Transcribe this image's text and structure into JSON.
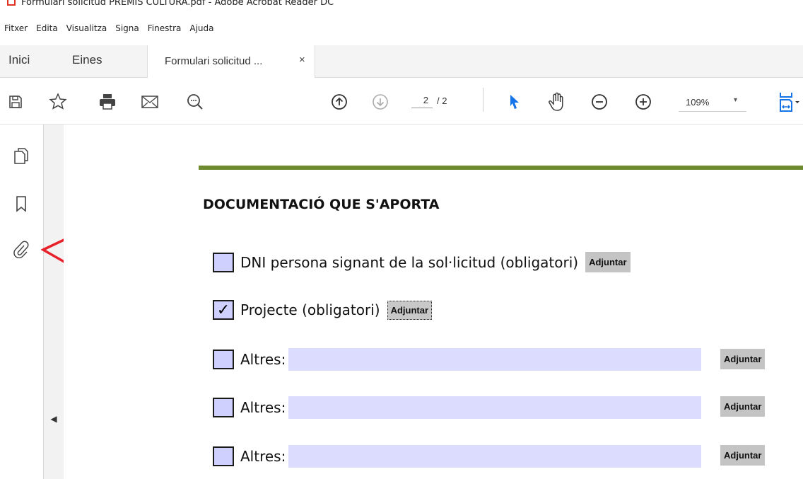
{
  "window": {
    "title": "Formulari solicitud PREMIS CULTURA.pdf - Adobe Acrobat Reader DC"
  },
  "menu": {
    "items": [
      {
        "label": "Fitxer"
      },
      {
        "label": "Edita"
      },
      {
        "label": "Visualitza"
      },
      {
        "label": "Signa"
      },
      {
        "label": "Finestra"
      },
      {
        "label": "Ajuda"
      }
    ]
  },
  "tabs": {
    "home": "Inici",
    "tools": "Eines",
    "document": "Formulari solicitud ...",
    "close": "×"
  },
  "toolbar": {
    "icons": [
      "save-icon",
      "bookmark-star-icon",
      "print-icon",
      "email-icon",
      "zoom-search-icon",
      "page-up-icon",
      "page-down-icon",
      "select-cursor-icon",
      "hand-tool-icon",
      "zoom-out-icon",
      "zoom-in-icon",
      "fit-page-icon"
    ],
    "page_current": "2",
    "page_total": "/ 2",
    "zoom": "109%",
    "zoom_caret": "▾"
  },
  "left_pane": {
    "icons": [
      "page-thumbnails-icon",
      "bookmarks-icon",
      "attachments-icon"
    ],
    "collapse": "◀"
  },
  "document": {
    "heading": "DOCUMENTACIÓ QUE S'APORTA",
    "items": [
      {
        "label": "DNI persona signant de la sol·licitud (obligatori)",
        "checked": false,
        "button": "Adjuntar"
      },
      {
        "label": "Projecte (obligatori)",
        "checked": true,
        "check_mark": "✓",
        "button": "Adjuntar"
      },
      {
        "label": "Altres:",
        "checked": false,
        "field_value": "",
        "button": "Adjuntar"
      },
      {
        "label": "Altres:",
        "checked": false,
        "field_value": "",
        "button": "Adjuntar"
      },
      {
        "label": "Altres:",
        "checked": false,
        "field_value": "",
        "button": "Adjuntar"
      }
    ]
  },
  "colors": {
    "accent_green": "#6e8b2f",
    "field_fill": "#dcdcff",
    "checkbox_fill": "#d0d0ff",
    "annotation_red": "#e8202a",
    "select_blue": "#1473e6"
  }
}
